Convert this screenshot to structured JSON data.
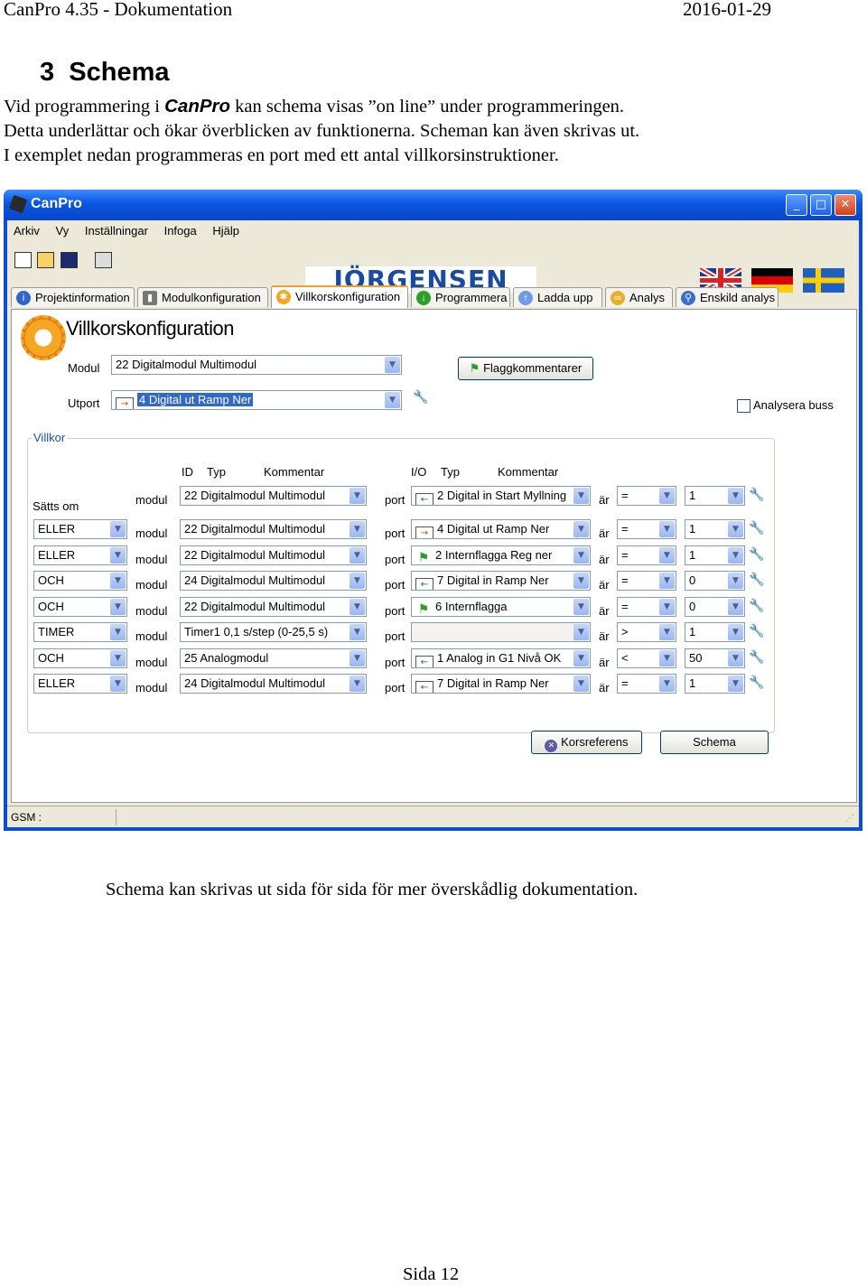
{
  "doc_header": {
    "left": "CanPro 4.35 - Dokumentation",
    "right": "2016-01-29"
  },
  "section": {
    "number": "3",
    "title": "Schema"
  },
  "intro": {
    "line1_pre": "Vid programmering i ",
    "brand": "CanPro",
    "line1_post": " kan schema visas ”on line” under programmeringen.",
    "line2": "Detta underlättar och ökar överblicken av funktionerna. Scheman kan även skrivas ut.",
    "line3": "I exemplet nedan programmeras en port med ett antal villkorsinstruktioner."
  },
  "window": {
    "title": "CanPro",
    "menu": [
      "Arkiv",
      "Vy",
      "Inställningar",
      "Infoga",
      "Hjälp"
    ],
    "logo": "JÖRGENSEN",
    "tabs": [
      "Projektinformation",
      "Modulkonfiguration",
      "Villkorskonfiguration",
      "Programmera",
      "Ladda upp",
      "Analys",
      "Enskild analys"
    ],
    "panel_title": "Villkorskonfiguration",
    "modul_label": "Modul",
    "modul_value": "22 Digitalmodul  Multimodul",
    "flag_button": "Flaggkommentarer",
    "utport_label": "Utport",
    "utport_value": "4   Digital ut   Ramp Ner",
    "analysera_label": "Analysera buss",
    "villkor_label": "Villkor",
    "col_headers": {
      "id": "ID",
      "typ": "Typ",
      "kommentar": "Kommentar",
      "io": "I/O",
      "typ2": "Typ",
      "kommentar2": "Kommentar"
    },
    "satts_om": "Sätts om",
    "word_modul": "modul",
    "word_port": "port",
    "word_ar": "är",
    "rows": [
      {
        "op": "",
        "module": "22 Digitalmodul  Multimodul",
        "port": "2   Digital in   Start Myllning",
        "pt": "in",
        "cmp": "=",
        "val": "1"
      },
      {
        "op": "ELLER",
        "module": "22 Digitalmodul  Multimodul",
        "port": "4   Digital ut   Ramp Ner",
        "pt": "out",
        "cmp": "=",
        "val": "1"
      },
      {
        "op": "ELLER",
        "module": "22 Digitalmodul  Multimodul",
        "port": "2 Internflagga Reg ner",
        "pt": "flag",
        "cmp": "=",
        "val": "1"
      },
      {
        "op": "OCH",
        "module": "24 Digitalmodul  Multimodul",
        "port": "7   Digital in   Ramp Ner",
        "pt": "in",
        "cmp": "=",
        "val": "0"
      },
      {
        "op": "OCH",
        "module": "22 Digitalmodul  Multimodul",
        "port": "6 Internflagga",
        "pt": "flag",
        "cmp": "=",
        "val": "0"
      },
      {
        "op": "TIMER",
        "module": "Timer1    0,1 s/step (0-25,5 s)",
        "port": "",
        "pt": "none",
        "cmp": ">",
        "val": "1"
      },
      {
        "op": "OCH",
        "module": "25 Analogmodul",
        "port": "1   Analog in   G1 Nivå OK",
        "pt": "in",
        "cmp": "<",
        "val": "50"
      },
      {
        "op": "ELLER",
        "module": "24 Digitalmodul  Multimodul",
        "port": "7   Digital in   Ramp Ner",
        "pt": "in",
        "cmp": "=",
        "val": "1"
      }
    ],
    "btn_korsref": "Korsreferens",
    "btn_schema": "Schema",
    "status": "GSM :"
  },
  "caption": "Schema kan skrivas ut sida för sida för mer överskådlig dokumentation.",
  "footer": "Sida 12"
}
